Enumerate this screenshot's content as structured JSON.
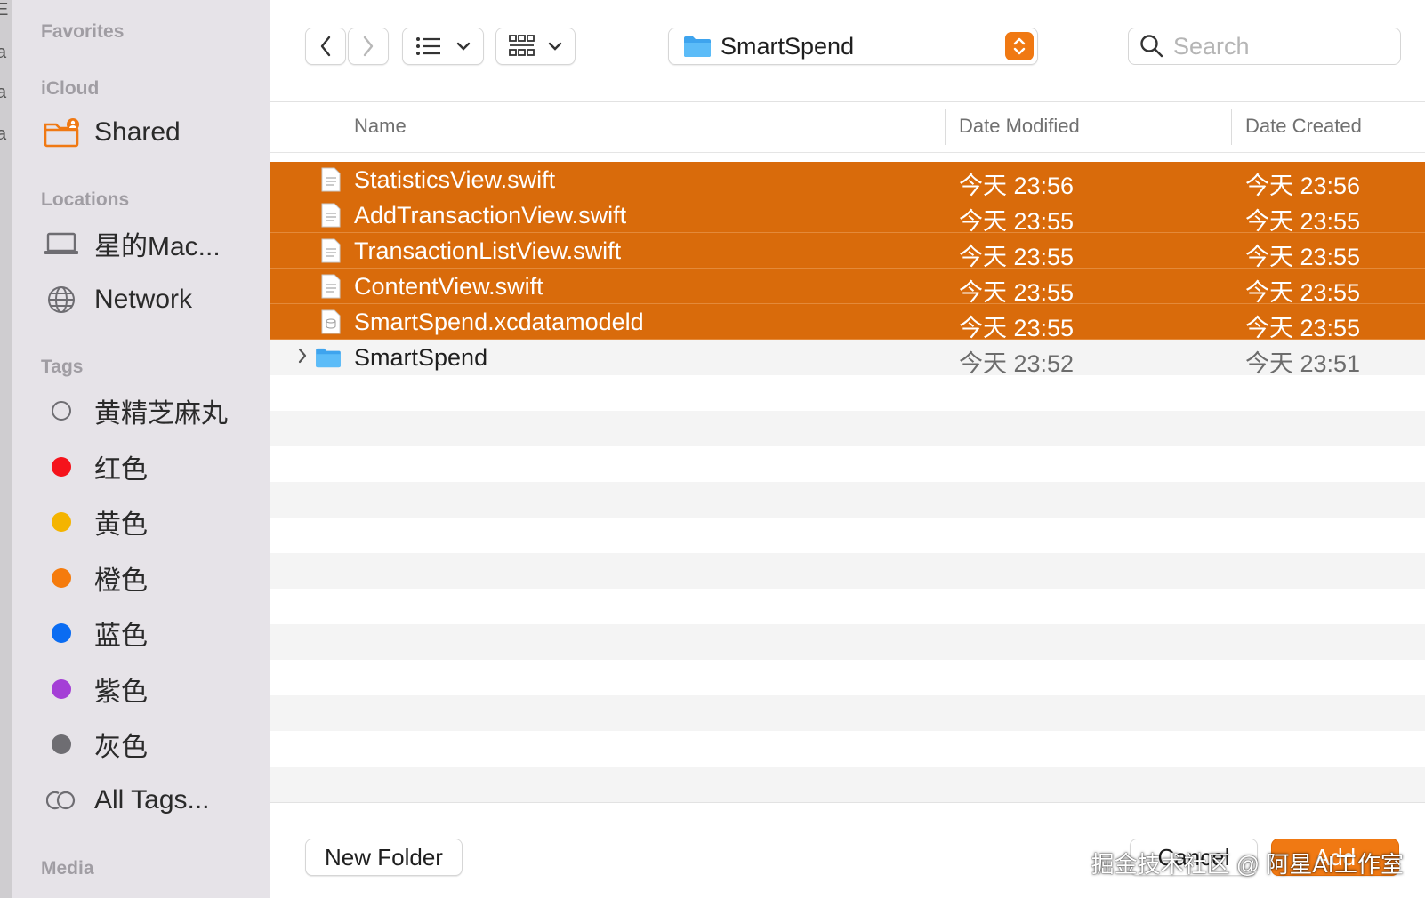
{
  "sidebar": {
    "sections": {
      "favorites": "Favorites",
      "icloud": "iCloud",
      "locations": "Locations",
      "tags": "Tags",
      "media": "Media"
    },
    "icloud_items": [
      {
        "label": "Shared",
        "icon": "shared-folder-icon"
      }
    ],
    "location_items": [
      {
        "label": "星的Mac...",
        "icon": "laptop-icon"
      },
      {
        "label": "Network",
        "icon": "globe-icon"
      }
    ],
    "tag_items": [
      {
        "label": "黄精芝麻丸",
        "color": "none"
      },
      {
        "label": "红色",
        "color": "#f5131b"
      },
      {
        "label": "黄色",
        "color": "#f4b400"
      },
      {
        "label": "橙色",
        "color": "#f57b0c"
      },
      {
        "label": "蓝色",
        "color": "#0a6cf2"
      },
      {
        "label": "紫色",
        "color": "#a43fd6"
      },
      {
        "label": "灰色",
        "color": "#6e6d72"
      },
      {
        "label": "All Tags...",
        "color": "all"
      }
    ]
  },
  "toolbar": {
    "current_folder": "SmartSpend",
    "search_placeholder": "Search"
  },
  "columns": {
    "name": "Name",
    "date_modified": "Date Modified",
    "date_created": "Date Created"
  },
  "files": [
    {
      "name": "StatisticsView.swift",
      "modified": "今天 23:56",
      "created": "今天 23:56",
      "selected": true,
      "type": "file"
    },
    {
      "name": "AddTransactionView.swift",
      "modified": "今天 23:55",
      "created": "今天 23:55",
      "selected": true,
      "type": "file"
    },
    {
      "name": "TransactionListView.swift",
      "modified": "今天 23:55",
      "created": "今天 23:55",
      "selected": true,
      "type": "file"
    },
    {
      "name": "ContentView.swift",
      "modified": "今天 23:55",
      "created": "今天 23:55",
      "selected": true,
      "type": "file"
    },
    {
      "name": "SmartSpend.xcdatamodeld",
      "modified": "今天 23:55",
      "created": "今天 23:55",
      "selected": true,
      "type": "datamodel"
    },
    {
      "name": "SmartSpend",
      "modified": "今天 23:52",
      "created": "今天 23:51",
      "selected": false,
      "type": "folder"
    }
  ],
  "buttons": {
    "new_folder": "New Folder",
    "cancel": "Cancel",
    "add": "Add"
  },
  "watermark": "掘金技术社区 @ 阿星AI工作室",
  "colors": {
    "accent": "#f07913",
    "selection": "#d96b0b"
  }
}
